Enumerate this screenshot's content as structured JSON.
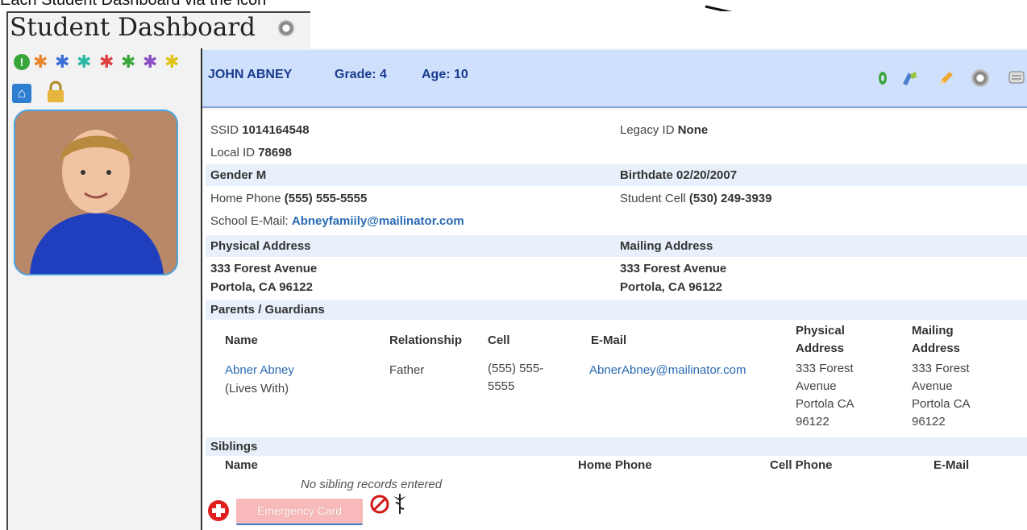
{
  "caption": "Each Student Dashboard via the icon",
  "page_title": "Student Dashboard",
  "student": {
    "name": "JOHN ABNEY",
    "grade": "Grade: 4",
    "age": "Age: 10"
  },
  "info": {
    "ssid_label": "SSID",
    "ssid": "1014164548",
    "legacy_label": "Legacy ID",
    "legacy": "None",
    "local_label": "Local ID",
    "local": "78698",
    "gender_label": "Gender",
    "gender": "M",
    "birth_label": "Birthdate",
    "birth": "02/20/2007",
    "home_phone_label": "Home Phone",
    "home_phone": "(555) 555-5555",
    "cell_label": "Student Cell",
    "cell": "(530) 249-3939",
    "email_label": "School E-Mail:",
    "email": "Abneyfamiily@mailinator.com",
    "physical_label": "Physical Address",
    "mailing_label": "Mailing Address",
    "phys_line1": "333 Forest Avenue",
    "phys_line2": "Portola, CA 96122",
    "mail_line1": "333 Forest Avenue",
    "mail_line2": "Portola, CA 96122"
  },
  "parents": {
    "section_label": "Parents / Guardians",
    "columns": [
      "Name",
      "Relationship",
      "Cell",
      "E-Mail",
      "Physical Address",
      "Mailing Address"
    ],
    "rows": [
      {
        "name": "Abner Abney",
        "lives": "(Lives With)",
        "relationship": "Father",
        "cell": "(555) 555-5555",
        "email": "AbnerAbney@mailinator.com",
        "physical": "333 Forest Avenue Portola CA 96122",
        "mailing": "333 Forest Avenue Portola CA 96122"
      }
    ]
  },
  "siblings": {
    "section_label": "Siblings",
    "columns": [
      "Name",
      "Home Phone",
      "Cell Phone",
      "E-Mail"
    ],
    "empty_text": "No sibling records entered"
  },
  "emergency_button": "Emergency Card",
  "colors": {
    "header_bg": "#cfe0fc",
    "band_bg": "#e8f0fb",
    "link": "#2a6ab3",
    "emergency": "#f7b9b9"
  },
  "icons": [
    "gear-icon",
    "info-icon",
    "star-icon",
    "home-icon",
    "lock-icon",
    "medal-icon",
    "pencil-icon",
    "chat-icon",
    "red-cross-icon",
    "no-symbol-icon",
    "caduceus-icon"
  ]
}
